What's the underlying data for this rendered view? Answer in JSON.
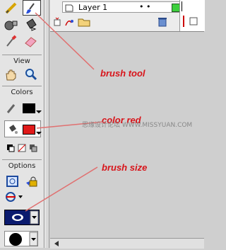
{
  "timeline": {
    "layer_name": "Layer 1",
    "layer_dots": "•  •"
  },
  "toolbox": {
    "view_label": "View",
    "colors_label": "Colors",
    "options_label": "Options",
    "fill_color": "#e01a1a",
    "stroke_color": "#000000"
  },
  "annotations": {
    "brush_tool": "brush tool",
    "color_red": "color red",
    "brush_size": "brush size"
  },
  "watermark": "思缘设计论坛  WWW.MISSYUAN.COM",
  "colors": {
    "annotation": "#d8141a",
    "line": "#e07070",
    "selected_shape": "#0a1a6e"
  }
}
